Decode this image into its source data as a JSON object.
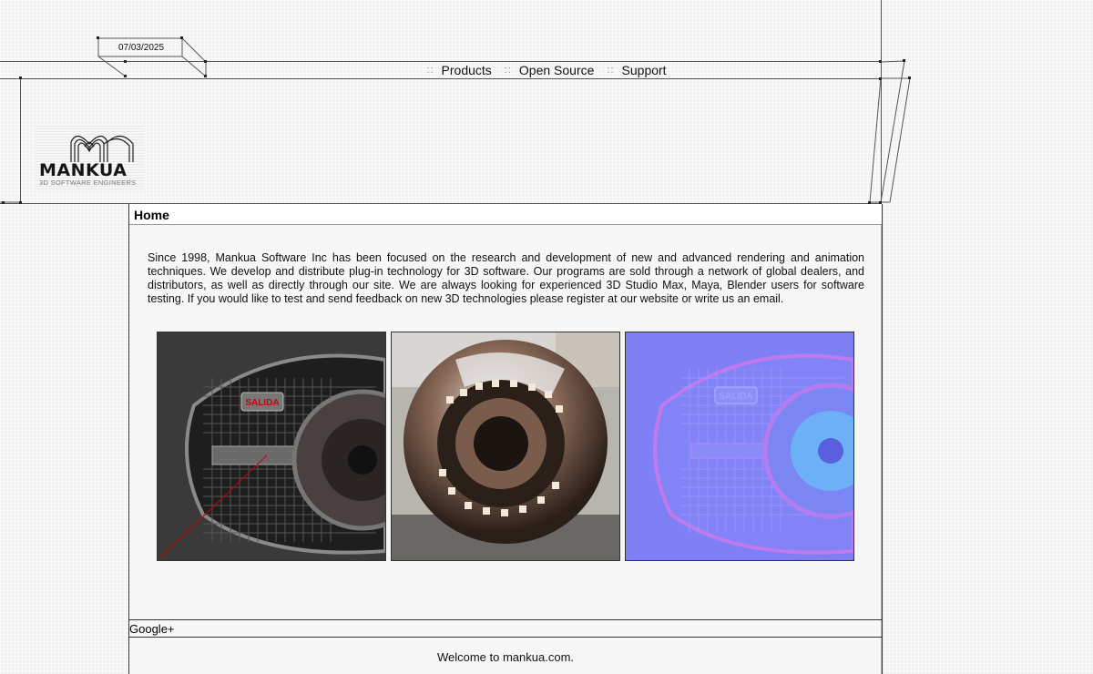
{
  "header": {
    "date": "07/03/2025"
  },
  "nav": {
    "separator": "::",
    "items": [
      {
        "label": "Products"
      },
      {
        "label": "Open Source"
      },
      {
        "label": "Support"
      }
    ]
  },
  "logo": {
    "name": "MANKUA",
    "tagline": "3D SOFTWARE ENGINEERS"
  },
  "main": {
    "title": "Home",
    "intro": "Since 1998, Mankua Software Inc has been focused on the research and development of new and advanced rendering and animation techniques. We develop and distribute plug-in technology for 3D software. Our programs are sold through a network of global dealers, and distributors, as well as directly through our site. We are always looking for experienced 3D Studio Max, Maya, Blender users for software testing. If you would like to test and send feedback on new 3D technologies please register at our website or write us an email.",
    "gallery": [
      {
        "badge": "SALIDA"
      },
      {},
      {
        "badge": "SALIDA"
      }
    ]
  },
  "footer": {
    "social": "Google+",
    "welcome": "Welcome to mankua.com."
  }
}
